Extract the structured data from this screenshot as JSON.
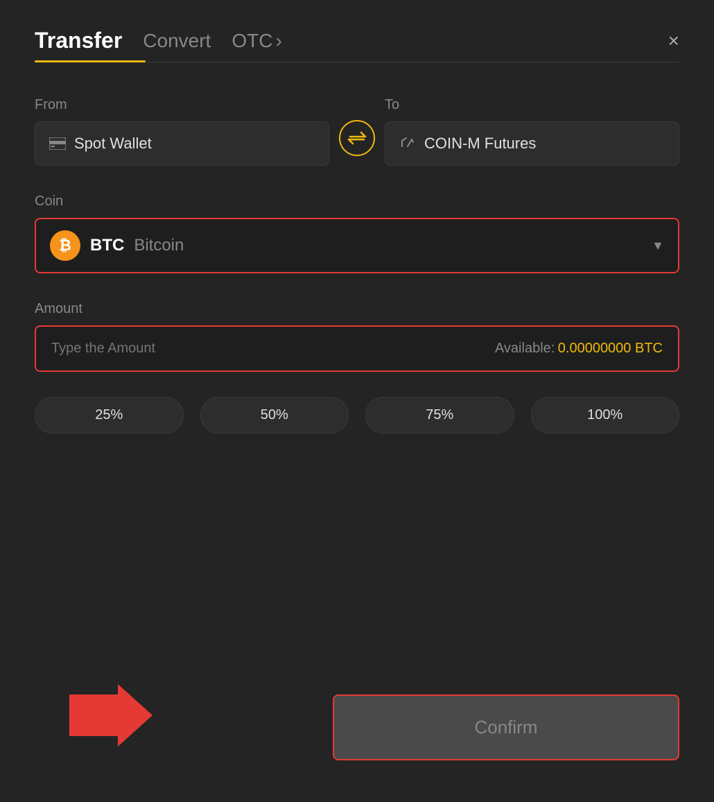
{
  "header": {
    "tab_transfer": "Transfer",
    "tab_convert": "Convert",
    "tab_otc": "OTC",
    "tab_otc_chevron": "›",
    "close_label": "×"
  },
  "from": {
    "label": "From",
    "wallet_icon": "card-icon",
    "wallet_name": "Spot Wallet"
  },
  "swap": {
    "icon": "⇄"
  },
  "to": {
    "label": "To",
    "wallet_icon": "futures-icon",
    "wallet_name": "COIN-M Futures"
  },
  "coin": {
    "label": "Coin",
    "symbol": "BTC",
    "name": "Bitcoin",
    "dropdown_arrow": "▼"
  },
  "amount": {
    "label": "Amount",
    "placeholder": "Type the Amount",
    "available_label": "Available:",
    "available_value": "0.00000000 BTC"
  },
  "percent_buttons": [
    {
      "label": "25%"
    },
    {
      "label": "50%"
    },
    {
      "label": "75%"
    },
    {
      "label": "100%"
    }
  ],
  "confirm_button": {
    "label": "Confirm"
  }
}
